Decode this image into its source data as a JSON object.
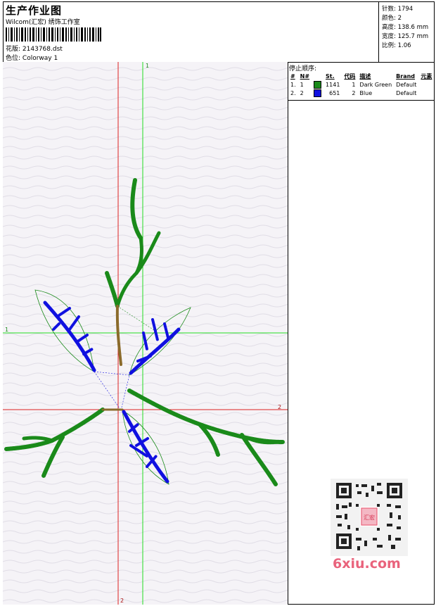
{
  "header": {
    "title": "生产作业图",
    "company": "Wilcom(汇宏) 绣饰工作室",
    "design_label": "花版:",
    "design_value": "2143768.dst",
    "colorway_label": "色位:",
    "colorway_value": "Colorway 1"
  },
  "specs": {
    "stitches_label": "针数:",
    "stitches_value": "1794",
    "colors_label": "颜色:",
    "colors_value": "2",
    "height_label": "高度:",
    "height_value": "138.6 mm",
    "width_label": "宽度:",
    "width_value": "125.7 mm",
    "ratio_label": "比例:",
    "ratio_value": "1.06"
  },
  "stop_sequence": {
    "label": "停止顺序:",
    "columns": [
      "#",
      "N#",
      "",
      "St.",
      "代码",
      "描述",
      "Brand",
      "元素"
    ],
    "rows": [
      {
        "index": "1.",
        "needle": "1",
        "color": "#1a8a1a",
        "stitches": "1141",
        "code": "1",
        "description": "Dark Green",
        "brand": "Default"
      },
      {
        "index": "2.",
        "needle": "2",
        "color": "#1010e0",
        "stitches": "651",
        "code": "2",
        "description": "Blue",
        "brand": "Default"
      }
    ]
  },
  "guides": {
    "green_label_1": "1",
    "green_label_2": "1",
    "red_label_1": "2",
    "red_label_2": "2"
  },
  "colors": {
    "green": "#1a8a1a",
    "blue": "#1010e0",
    "guide_green": "#22dd22",
    "guide_red": "#dd2222"
  },
  "watermark": "6xiu.com",
  "qr_badge": "汇宏"
}
